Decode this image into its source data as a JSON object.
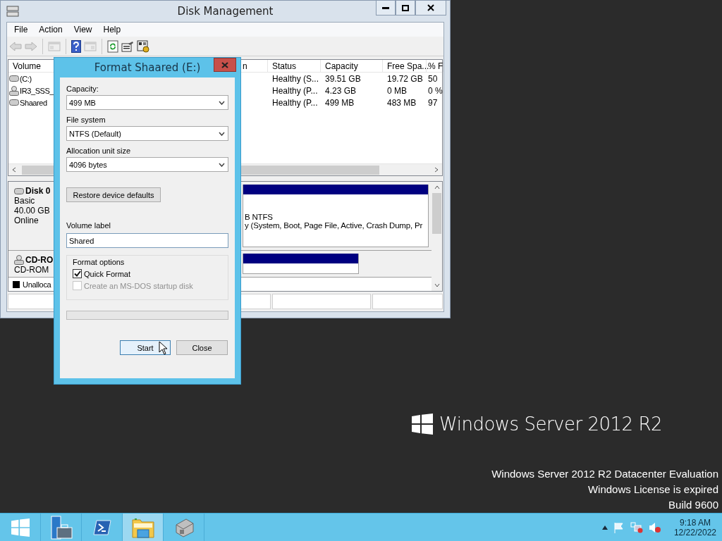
{
  "disk_management": {
    "title": "Disk Management",
    "menu": [
      "File",
      "Action",
      "View",
      "Help"
    ],
    "toolbar": [
      {
        "kind": "back",
        "disabled": true
      },
      {
        "kind": "forward",
        "disabled": true
      },
      {
        "kind": "tree",
        "disabled": true
      },
      {
        "kind": "help",
        "disabled": false
      },
      {
        "kind": "pane",
        "disabled": true
      },
      {
        "kind": "refresh",
        "disabled": false
      },
      {
        "kind": "properties",
        "disabled": false
      },
      {
        "kind": "settings",
        "disabled": false
      }
    ],
    "volume_table": {
      "columns": [
        "Volume",
        "n",
        "Status",
        "Capacity",
        "Free Spa...",
        "% F"
      ],
      "rows": [
        {
          "kind": "disk",
          "cells": [
            "(C:)",
            "",
            "Healthy (S...",
            "39.51 GB",
            "19.72 GB",
            "50"
          ]
        },
        {
          "kind": "cd",
          "cells": [
            "IR3_SSS_",
            "",
            "Healthy (P...",
            "4.23 GB",
            "0 MB",
            "0 %"
          ]
        },
        {
          "kind": "disk",
          "cells": [
            "Shaared",
            "",
            "Healthy (P...",
            "499 MB",
            "483 MB",
            "97"
          ]
        }
      ]
    },
    "disks": [
      {
        "kind": "disk",
        "name": "Disk 0",
        "lines": [
          "Basic",
          "40.00 GB",
          "Online"
        ],
        "partition_lines": [
          "B NTFS",
          "y (System, Boot, Page File, Active, Crash Dump, Pr"
        ]
      },
      {
        "kind": "cd",
        "name": "CD-RO",
        "lines": [
          "CD-ROM"
        ]
      }
    ],
    "legend": [
      {
        "label": "Unalloca",
        "color": "#000000"
      }
    ]
  },
  "format_dialog": {
    "title": "Format Shaared (E:)",
    "capacity": {
      "label": "Capacity:",
      "value": "499 MB"
    },
    "file_system": {
      "label": "File system",
      "value": "NTFS (Default)"
    },
    "allocation_unit_size": {
      "label": "Allocation unit size",
      "value": "4096 bytes"
    },
    "restore_button": "Restore device defaults",
    "volume_label": {
      "label": "Volume label",
      "value": "Shared"
    },
    "format_options": {
      "title": "Format options",
      "options": [
        {
          "label": "Quick Format",
          "checked": true,
          "disabled": false
        },
        {
          "label": "Create an MS-DOS startup disk",
          "checked": false,
          "disabled": true
        }
      ]
    },
    "progress": {
      "level": 0
    },
    "buttons": [
      {
        "label": "Start",
        "focused": true
      },
      {
        "label": "Close",
        "focused": false
      }
    ]
  },
  "desktop": {
    "brand": "Windows Server 2012 R2",
    "info": [
      "Windows Server 2012 R2 Datacenter Evaluation",
      "Windows License is expired",
      "Build 9600"
    ]
  },
  "taskbar": {
    "apps": [
      {
        "kind": "server-manager",
        "selected": false
      },
      {
        "kind": "powershell",
        "selected": false
      },
      {
        "kind": "explorer",
        "selected": true
      },
      {
        "kind": "removable",
        "selected": false
      }
    ],
    "clock": {
      "time": "9:18 AM",
      "date": "12/22/2022"
    }
  }
}
